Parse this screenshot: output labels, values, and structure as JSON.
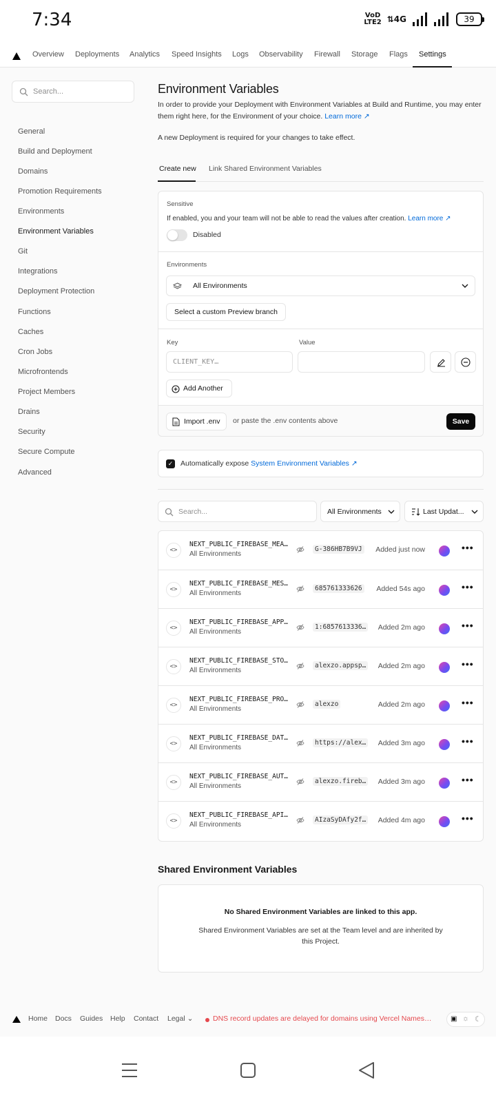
{
  "status_bar": {
    "time": "7:34",
    "volte_top": "VoD",
    "volte_bottom": "LTE2",
    "network": "4G",
    "battery": "39"
  },
  "top_nav": {
    "tabs": [
      "Overview",
      "Deployments",
      "Analytics",
      "Speed Insights",
      "Logs",
      "Observability",
      "Firewall",
      "Storage",
      "Flags",
      "Settings"
    ],
    "active": "Settings"
  },
  "sidebar": {
    "search_placeholder": "Search...",
    "items": [
      "General",
      "Build and Deployment",
      "Domains",
      "Promotion Requirements",
      "Environments",
      "Environment Variables",
      "Git",
      "Integrations",
      "Deployment Protection",
      "Functions",
      "Caches",
      "Cron Jobs",
      "Microfrontends",
      "Project Members",
      "Drains",
      "Security",
      "Secure Compute",
      "Advanced"
    ],
    "active": "Environment Variables"
  },
  "main": {
    "title": "Environment Variables",
    "intro": "In order to provide your Deployment with Environment Variables at Build and Runtime, you may enter them right here, for the Environment of your choice.",
    "learn_more": "Learn more",
    "notice": "A new Deployment is required for your changes to take effect.",
    "tabs": [
      "Create new",
      "Link Shared Environment Variables"
    ],
    "form": {
      "sensitive_label": "Sensitive",
      "sensitive_desc": "If enabled, you and your team will not be able to read the values after creation.",
      "learn_more": "Learn more",
      "toggle_state": "Disabled",
      "environments_label": "Environments",
      "environments_value": "All Environments",
      "custom_branch_button": "Select a custom Preview branch",
      "key_label": "Key",
      "value_label": "Value",
      "key_placeholder": "CLIENT_KEY…",
      "add_another": "Add Another",
      "import_button": "Import .env",
      "paste_hint": "or paste the .env contents above",
      "save": "Save"
    },
    "expose": {
      "text": "Automatically expose",
      "link": "System Environment Variables",
      "checked": true
    },
    "filters": {
      "search_placeholder": "Search...",
      "env_filter": "All Environments",
      "sort": "Last Updat..."
    },
    "variables": [
      {
        "key": "NEXT_PUBLIC_FIREBASE_MEA…",
        "env": "All Environments",
        "value": "G-386HB7B9VJ",
        "added": "Added just now"
      },
      {
        "key": "NEXT_PUBLIC_FIREBASE_MES…",
        "env": "All Environments",
        "value": "685761333626",
        "added": "Added 54s ago"
      },
      {
        "key": "NEXT_PUBLIC_FIREBASE_APP…",
        "env": "All Environments",
        "value": "1:6857613336…",
        "added": "Added 2m ago"
      },
      {
        "key": "NEXT_PUBLIC_FIREBASE_STO…",
        "env": "All Environments",
        "value": "alexzo.appsp…",
        "added": "Added 2m ago"
      },
      {
        "key": "NEXT_PUBLIC_FIREBASE_PRO…",
        "env": "All Environments",
        "value": "alexzo",
        "added": "Added 2m ago"
      },
      {
        "key": "NEXT_PUBLIC_FIREBASE_DAT…",
        "env": "All Environments",
        "value": "https://alex…",
        "added": "Added 3m ago"
      },
      {
        "key": "NEXT_PUBLIC_FIREBASE_AUT…",
        "env": "All Environments",
        "value": "alexzo.fireb…",
        "added": "Added 3m ago"
      },
      {
        "key": "NEXT_PUBLIC_FIREBASE_API…",
        "env": "All Environments",
        "value": "AIzaSyDAfy2f…",
        "added": "Added 4m ago"
      }
    ],
    "shared": {
      "title": "Shared Environment Variables",
      "empty_title": "No Shared Environment Variables are linked to this app.",
      "empty_desc": "Shared Environment Variables are set at the Team level and are inherited by this Project."
    }
  },
  "footer": {
    "links": [
      "Home",
      "Docs",
      "Guides",
      "Help",
      "Contact",
      "Legal"
    ],
    "status": "DNS record updates are delayed for domains using Vercel Nameser…"
  },
  "colors": {
    "accent": "#0069d9",
    "status_red": "#e5484d",
    "save_bg": "#0a0a0a"
  }
}
